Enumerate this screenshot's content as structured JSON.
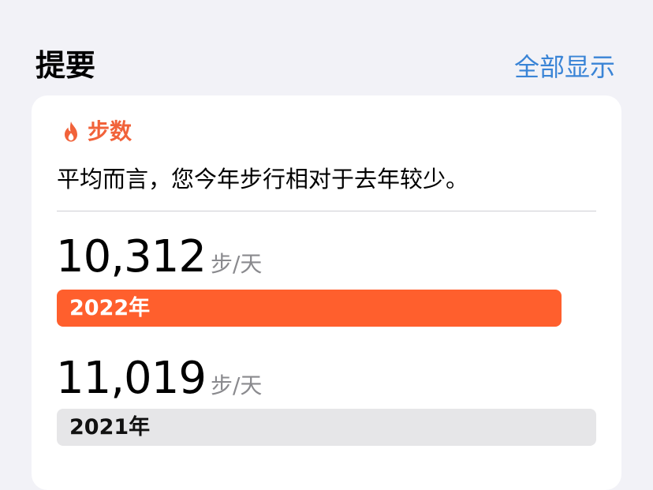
{
  "header": {
    "title": "提要",
    "show_all": "全部显示"
  },
  "card": {
    "icon": "flame-icon",
    "metric": "步数",
    "summary": "平均而言，您今年步行相对于去年较少。",
    "accent_color": "#f1623a",
    "unit_steps": "步",
    "unit_per": "/天",
    "entries": [
      {
        "value": "10,312",
        "year": "2022年",
        "avg_steps": 10312,
        "bar_fraction": 0.935,
        "bar_color": "#ff5f2d"
      },
      {
        "value": "11,019",
        "year": "2021年",
        "avg_steps": 11019,
        "bar_fraction": 1.0,
        "bar_color": "#e6e6e8"
      }
    ]
  }
}
